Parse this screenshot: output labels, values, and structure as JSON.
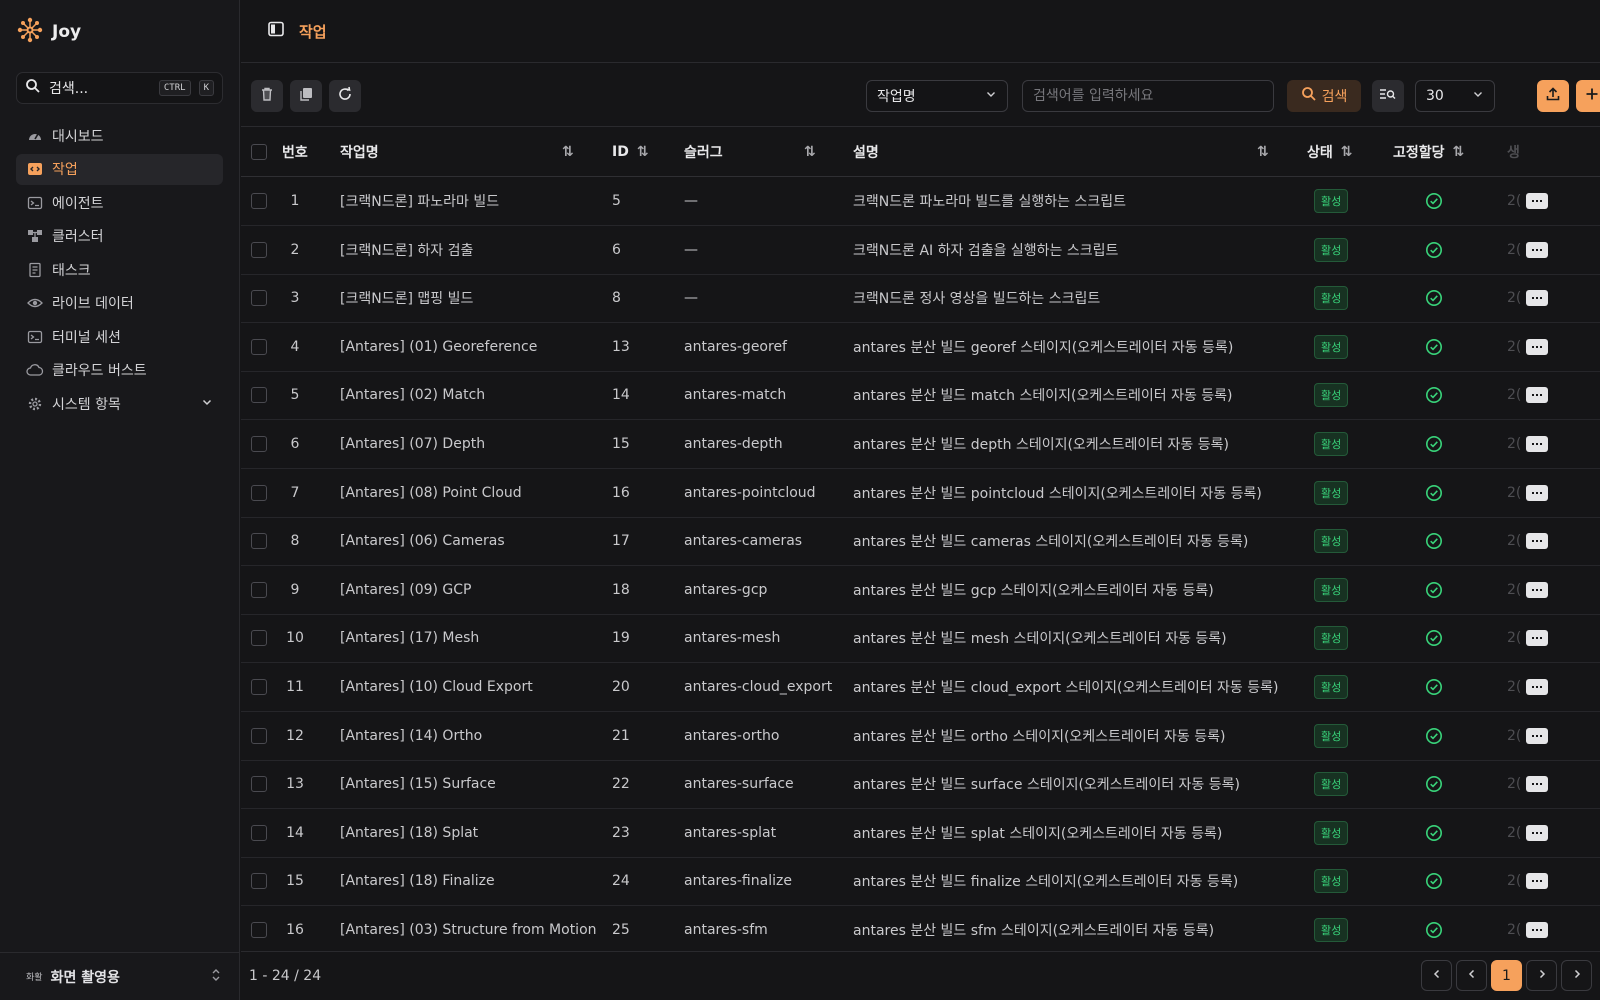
{
  "app": {
    "name": "Joy"
  },
  "sidebar": {
    "search_label": "검색...",
    "shortcut": [
      "CTRL",
      "K"
    ],
    "items": [
      {
        "label": "대시보드",
        "icon": "gauge-icon",
        "active": false
      },
      {
        "label": "작업",
        "icon": "code-icon",
        "active": true
      },
      {
        "label": "에이전트",
        "icon": "terminal-icon",
        "active": false
      },
      {
        "label": "클러스터",
        "icon": "cluster-icon",
        "active": false
      },
      {
        "label": "태스크",
        "icon": "document-icon",
        "active": false
      },
      {
        "label": "라이브 데이터",
        "icon": "eye-icon",
        "active": false
      },
      {
        "label": "터미널 세션",
        "icon": "terminal-icon",
        "active": false
      },
      {
        "label": "클라우드 버스트",
        "icon": "cloud-icon",
        "active": false
      },
      {
        "label": "시스템 항목",
        "icon": "gear-icon",
        "active": false,
        "expandable": true
      }
    ],
    "workspace": {
      "badge": "화활",
      "name": "화면 촬영용"
    }
  },
  "header": {
    "breadcrumb": "작업"
  },
  "toolbar": {
    "field_select": "작업명",
    "search_placeholder": "검색어를 입력하세요",
    "search_button": "검색",
    "page_size": "30"
  },
  "table": {
    "columns": {
      "no": "번호",
      "name": "작업명",
      "id": "ID",
      "slug": "슬러그",
      "desc": "설명",
      "status": "상태",
      "fixed": "고정할당",
      "extra": "생"
    },
    "rows": [
      {
        "no": "1",
        "name": "[크랙N드론] 파노라마 빌드",
        "id": "5",
        "slug": "—",
        "desc": "크랙N드론 파노라마 빌드를 실행하는 스크립트",
        "status": "활성",
        "extra": "2("
      },
      {
        "no": "2",
        "name": "[크랙N드론] 하자 검출",
        "id": "6",
        "slug": "—",
        "desc": "크랙N드론 AI 하자 검출을 실행하는 스크립트",
        "status": "활성",
        "extra": "2("
      },
      {
        "no": "3",
        "name": "[크랙N드론] 맵핑 빌드",
        "id": "8",
        "slug": "—",
        "desc": "크랙N드론 정사 영상을 빌드하는 스크립트",
        "status": "활성",
        "extra": "2("
      },
      {
        "no": "4",
        "name": "[Antares] (01) Georeference",
        "id": "13",
        "slug": "antares-georef",
        "desc": "antares 분산 빌드 georef 스테이지(오케스트레이터 자동 등록)",
        "status": "활성",
        "extra": "2("
      },
      {
        "no": "5",
        "name": "[Antares] (02) Match",
        "id": "14",
        "slug": "antares-match",
        "desc": "antares 분산 빌드 match 스테이지(오케스트레이터 자동 등록)",
        "status": "활성",
        "extra": "2("
      },
      {
        "no": "6",
        "name": "[Antares] (07) Depth",
        "id": "15",
        "slug": "antares-depth",
        "desc": "antares 분산 빌드 depth 스테이지(오케스트레이터 자동 등록)",
        "status": "활성",
        "extra": "2("
      },
      {
        "no": "7",
        "name": "[Antares] (08) Point Cloud",
        "id": "16",
        "slug": "antares-pointcloud",
        "desc": "antares 분산 빌드 pointcloud 스테이지(오케스트레이터 자동 등록)",
        "status": "활성",
        "extra": "2("
      },
      {
        "no": "8",
        "name": "[Antares] (06) Cameras",
        "id": "17",
        "slug": "antares-cameras",
        "desc": "antares 분산 빌드 cameras 스테이지(오케스트레이터 자동 등록)",
        "status": "활성",
        "extra": "2("
      },
      {
        "no": "9",
        "name": "[Antares] (09) GCP",
        "id": "18",
        "slug": "antares-gcp",
        "desc": "antares 분산 빌드 gcp 스테이지(오케스트레이터 자동 등록)",
        "status": "활성",
        "extra": "2("
      },
      {
        "no": "10",
        "name": "[Antares] (17) Mesh",
        "id": "19",
        "slug": "antares-mesh",
        "desc": "antares 분산 빌드 mesh 스테이지(오케스트레이터 자동 등록)",
        "status": "활성",
        "extra": "2("
      },
      {
        "no": "11",
        "name": "[Antares] (10) Cloud Export",
        "id": "20",
        "slug": "antares-cloud_export",
        "desc": "antares 분산 빌드 cloud_export 스테이지(오케스트레이터 자동 등록)",
        "status": "활성",
        "extra": "2("
      },
      {
        "no": "12",
        "name": "[Antares] (14) Ortho",
        "id": "21",
        "slug": "antares-ortho",
        "desc": "antares 분산 빌드 ortho 스테이지(오케스트레이터 자동 등록)",
        "status": "활성",
        "extra": "2("
      },
      {
        "no": "13",
        "name": "[Antares] (15) Surface",
        "id": "22",
        "slug": "antares-surface",
        "desc": "antares 분산 빌드 surface 스테이지(오케스트레이터 자동 등록)",
        "status": "활성",
        "extra": "2("
      },
      {
        "no": "14",
        "name": "[Antares] (18) Splat",
        "id": "23",
        "slug": "antares-splat",
        "desc": "antares 분산 빌드 splat 스테이지(오케스트레이터 자동 등록)",
        "status": "활성",
        "extra": "2("
      },
      {
        "no": "15",
        "name": "[Antares] (18) Finalize",
        "id": "24",
        "slug": "antares-finalize",
        "desc": "antares 분산 빌드 finalize 스테이지(오케스트레이터 자동 등록)",
        "status": "활성",
        "extra": "2("
      },
      {
        "no": "16",
        "name": "[Antares] (03) Structure from Motion",
        "id": "25",
        "slug": "antares-sfm",
        "desc": "antares 분산 빌드 sfm 스테이지(오케스트레이터 자동 등록)",
        "status": "활성",
        "extra": "2("
      }
    ]
  },
  "footer": {
    "range": "1 - 24 / 24",
    "current_page": "1"
  },
  "colors": {
    "accent": "#f6a15c",
    "status_green": "#39d37a",
    "background": "#151517"
  }
}
